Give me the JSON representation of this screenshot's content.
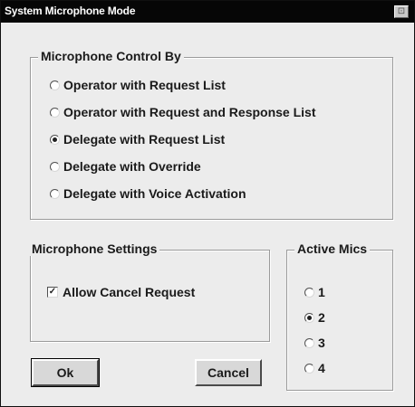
{
  "window": {
    "title": "System Microphone Mode",
    "close_glyph": "⊡"
  },
  "control_group": {
    "legend": "Microphone Control By",
    "options": [
      {
        "label": "Operator with Request List",
        "selected": false
      },
      {
        "label": "Operator with Request and Response List",
        "selected": false
      },
      {
        "label": "Delegate with Request List",
        "selected": true
      },
      {
        "label": "Delegate with Override",
        "selected": false
      },
      {
        "label": "Delegate with Voice Activation",
        "selected": false
      }
    ]
  },
  "settings_group": {
    "legend": "Microphone Settings",
    "allow_cancel_label": "Allow Cancel Request",
    "allow_cancel_checked": true,
    "check_glyph": "✓"
  },
  "mics_group": {
    "legend": "Active Mics",
    "options": [
      {
        "label": "1",
        "selected": false
      },
      {
        "label": "2",
        "selected": true
      },
      {
        "label": "3",
        "selected": false
      },
      {
        "label": "4",
        "selected": false
      }
    ]
  },
  "buttons": {
    "ok_label": "Ok",
    "cancel_label": "Cancel"
  },
  "icons": {
    "close": "close-icon",
    "check": "checkmark-icon"
  }
}
